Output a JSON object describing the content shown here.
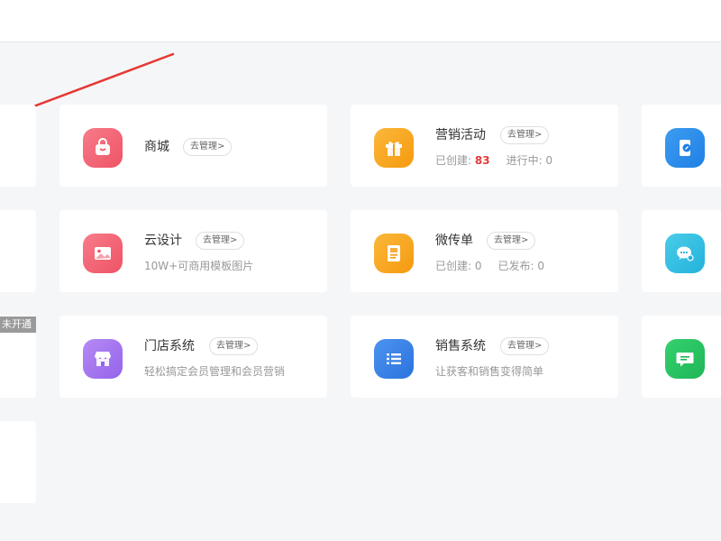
{
  "colors": {
    "page_bg": "#f5f6f8",
    "card_bg": "#ffffff",
    "highlight": "#e5393a",
    "arrow": "#e53935",
    "pink": "#f06677",
    "orange": "#f9a31c",
    "purple": "#a273ef",
    "blue": "#2f7fe6",
    "cyan": "#27bde2",
    "green": "#22c55e"
  },
  "left_badge": "未开通",
  "modules": {
    "mall": {
      "title": "商城",
      "manage": "去管理>",
      "icon": "shopping-bag-icon"
    },
    "marketing": {
      "title": "营销活动",
      "manage": "去管理>",
      "icon": "gift-icon",
      "created_label": "已创建:",
      "created_value": "83",
      "running_label": "进行中:",
      "running_value": "0"
    },
    "cloud_design": {
      "title": "云设计",
      "manage": "去管理>",
      "desc": "10W+可商用模板图片",
      "icon": "image-icon"
    },
    "leaflet": {
      "title": "微传单",
      "manage": "去管理>",
      "icon": "leaflet-icon",
      "created_label": "已创建:",
      "created_value": "0",
      "published_label": "已发布:",
      "published_value": "0"
    },
    "store_system": {
      "title": "门店系统",
      "manage": "去管理>",
      "desc": "轻松搞定会员管理和会员营销",
      "icon": "store-icon"
    },
    "sales_system": {
      "title": "销售系统",
      "manage": "去管理>",
      "desc": "让获客和销售变得简单",
      "icon": "list-icon"
    }
  },
  "right_icons": [
    "mobile-link-icon",
    "wechat-settings-icon",
    "message-icon"
  ]
}
